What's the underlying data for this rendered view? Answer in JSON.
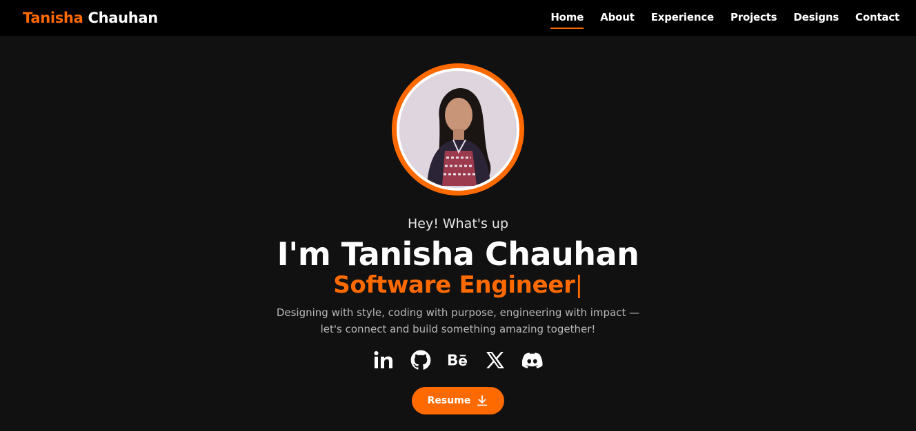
{
  "brand": {
    "first": "Tanisha",
    "last": "Chauhan"
  },
  "nav": {
    "items": [
      {
        "label": "Home",
        "active": true
      },
      {
        "label": "About",
        "active": false
      },
      {
        "label": "Experience",
        "active": false
      },
      {
        "label": "Projects",
        "active": false
      },
      {
        "label": "Designs",
        "active": false
      },
      {
        "label": "Contact",
        "active": false
      }
    ]
  },
  "hero": {
    "greeting": "Hey! What's up",
    "name": "I'm Tanisha Chauhan",
    "role": "Software Engineer",
    "caret": "|",
    "tagline": "Designing with style, coding with purpose, engineering with impact — let's connect and build something amazing together!",
    "resume_label": "Resume"
  },
  "socials": [
    {
      "icon": "linkedin-icon"
    },
    {
      "icon": "github-icon"
    },
    {
      "icon": "behance-icon"
    },
    {
      "icon": "x-icon"
    },
    {
      "icon": "discord-icon"
    }
  ],
  "colors": {
    "accent": "#ff6a00",
    "background": "#111111",
    "navbar": "#000000"
  }
}
